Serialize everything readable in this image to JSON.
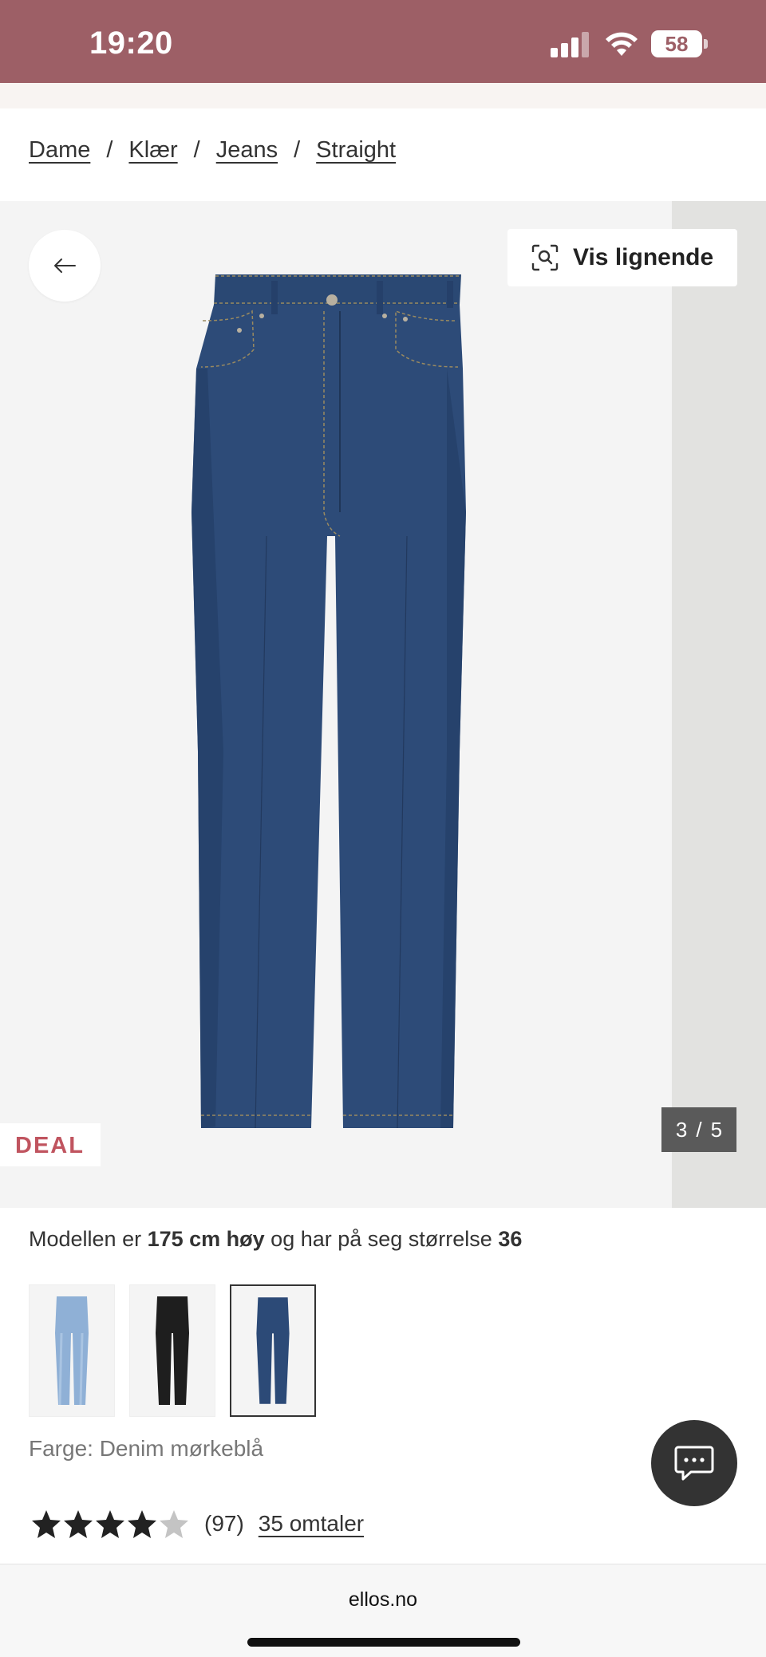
{
  "status_bar": {
    "time": "19:20",
    "battery": "58"
  },
  "breadcrumb": [
    {
      "label": "Dame"
    },
    {
      "label": "Klær"
    },
    {
      "label": "Jeans"
    },
    {
      "label": "Straight"
    }
  ],
  "breadcrumb_separator": "/",
  "gallery": {
    "similar_button": "Vis lignende",
    "badge": "DEAL",
    "pager": {
      "current": "3",
      "separator": "/",
      "total": "5"
    }
  },
  "model_info": {
    "prefix": "Modellen er ",
    "height": "175 cm høy",
    "middle": " og har på seg størrelse ",
    "size": "36"
  },
  "colors": {
    "swatches": [
      {
        "name": "light-blue",
        "color": "#8fb0d6"
      },
      {
        "name": "black",
        "color": "#1e1e1e"
      },
      {
        "name": "denim-dark-blue",
        "color": "#2c4a77",
        "selected": true
      }
    ],
    "label": "Farge: Denim mørkeblå"
  },
  "rating": {
    "stars_filled": 4,
    "stars_total": 5,
    "count": "(97)",
    "reviews_link": "35 omtaler"
  },
  "browser": {
    "url": "ellos.no"
  },
  "theme": {
    "status_bar": "#9d5f66",
    "deal_red": "#c0545f",
    "denim": "#2d4b78"
  }
}
